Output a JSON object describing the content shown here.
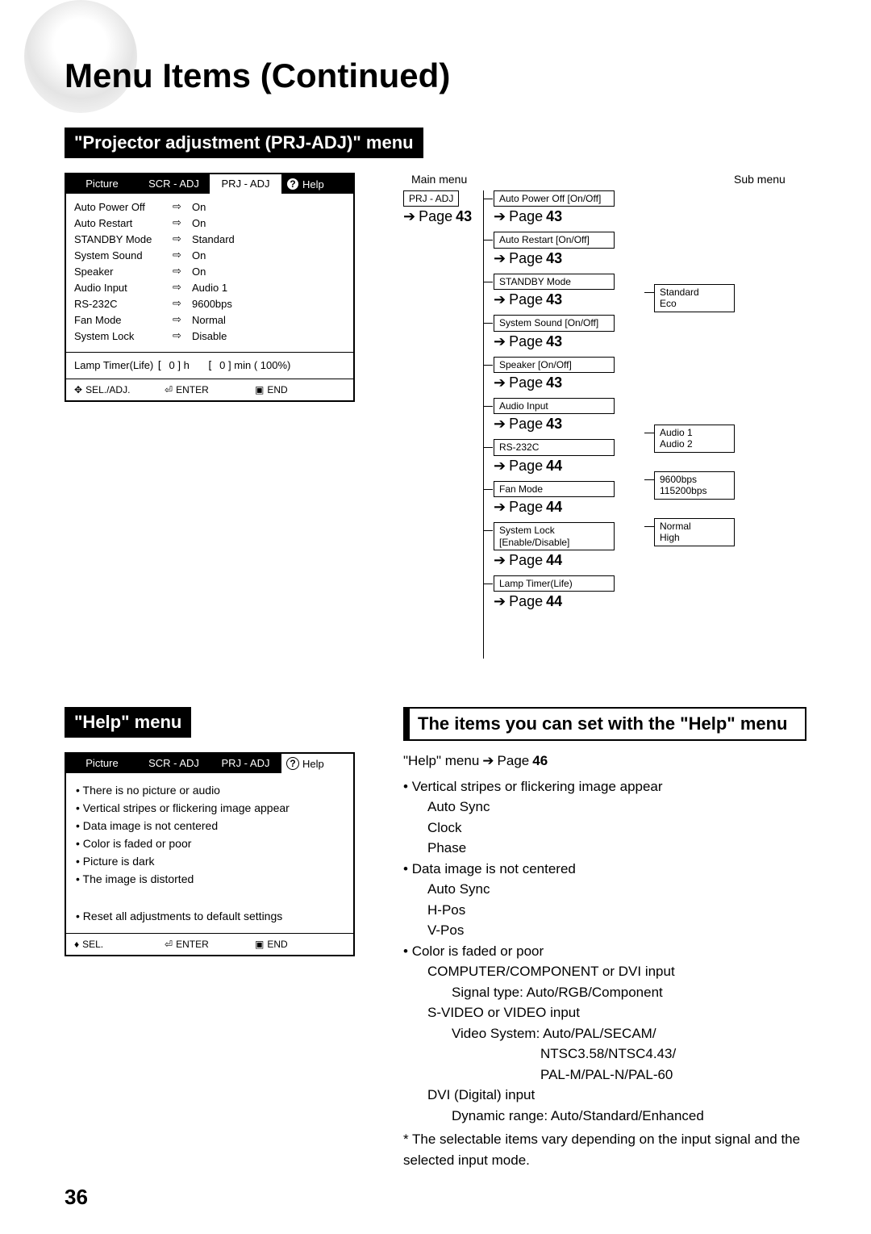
{
  "title": "Menu Items (Continued)",
  "page_number": "36",
  "prj_section_header": "\"Projector adjustment (PRJ-ADJ)\" menu",
  "help_section_header": "\"Help\" menu",
  "osd_tabs": {
    "picture": "Picture",
    "scr_adj": "SCR - ADJ",
    "prj_adj": "PRJ - ADJ",
    "help": "Help"
  },
  "osd_prj_items": [
    {
      "label": "Auto Power Off",
      "value": "On"
    },
    {
      "label": "Auto Restart",
      "value": "On"
    },
    {
      "label": "STANDBY Mode",
      "value": "Standard"
    },
    {
      "label": "System Sound",
      "value": "On"
    },
    {
      "label": "Speaker",
      "value": "On"
    },
    {
      "label": "Audio Input",
      "value": "Audio 1"
    },
    {
      "label": "RS-232C",
      "value": "9600bps"
    },
    {
      "label": "Fan Mode",
      "value": "Normal"
    },
    {
      "label": "System Lock",
      "value": "Disable"
    }
  ],
  "lamp_line": {
    "label": "Lamp Timer(Life)",
    "h": "0",
    "h_unit": "h",
    "min": "0",
    "min_unit": "min",
    "pct": "( 100%)"
  },
  "osd_footer": {
    "sel": "SEL./ADJ.",
    "enter": "ENTER",
    "end": "END"
  },
  "osd_footer_help": {
    "sel": "SEL.",
    "enter": "ENTER",
    "end": "END"
  },
  "tree_headers": {
    "main": "Main menu",
    "sub": "Sub menu"
  },
  "tree": {
    "root": "PRJ - ADJ",
    "root_page": "Page 43",
    "nodes": [
      {
        "box": "Auto Power Off [On/Off]",
        "page": "Page 43",
        "sub": []
      },
      {
        "box": "Auto Restart [On/Off]",
        "page": "Page 43",
        "sub": []
      },
      {
        "box": "STANDBY Mode",
        "page": "Page 43",
        "sub": [
          "Standard",
          "Eco"
        ]
      },
      {
        "box": "System Sound [On/Off]",
        "page": "Page 43",
        "sub": []
      },
      {
        "box": "Speaker [On/Off]",
        "page": "Page 43",
        "sub": []
      },
      {
        "box": "Audio Input",
        "page": "Page 43",
        "sub": [
          "Audio 1",
          "Audio 2"
        ]
      },
      {
        "box": "RS-232C",
        "page": "Page 44",
        "sub": [
          "9600bps",
          "115200bps"
        ]
      },
      {
        "box": "Fan Mode",
        "page": "Page 44",
        "sub": [
          "Normal",
          "High"
        ]
      },
      {
        "box": "System Lock\n[Enable/Disable]",
        "page": "Page 44",
        "sub": []
      },
      {
        "box": "Lamp Timer(Life)",
        "page": "Page 44",
        "sub": []
      }
    ]
  },
  "help_osd_items": [
    "There is no picture or audio",
    "Vertical stripes or flickering image appear",
    "Data image is not centered",
    "Color is faded or poor",
    "Picture is dark",
    "The image is distorted"
  ],
  "help_osd_reset": "Reset all adjustments to default settings",
  "help_title": "The items you can set with the \"Help\" menu",
  "help_page_ref": {
    "prefix": "\"Help\" menu",
    "arrow": "→",
    "page": "Page",
    "num": "46"
  },
  "help_content": {
    "b1": {
      "t": "Vertical stripes or flickering image appear",
      "s": [
        "Auto Sync",
        "Clock",
        "Phase"
      ]
    },
    "b2": {
      "t": "Data image is not centered",
      "s": [
        "Auto Sync",
        "H-Pos",
        "V-Pos"
      ]
    },
    "b3": {
      "t": "Color is faded or poor",
      "groups": [
        {
          "h": "COMPUTER/COMPONENT or DVI input",
          "l": [
            "Signal type: Auto/RGB/Component"
          ]
        },
        {
          "h": "S-VIDEO or VIDEO input",
          "l": [
            "Video System: Auto/PAL/SECAM/",
            "NTSC3.58/NTSC4.43/",
            "PAL-M/PAL-N/PAL-60"
          ]
        },
        {
          "h": "DVI (Digital) input",
          "l": [
            "Dynamic range: Auto/Standard/Enhanced"
          ]
        }
      ]
    },
    "footnote": "* The selectable items vary depending on the input signal and the selected input mode."
  }
}
